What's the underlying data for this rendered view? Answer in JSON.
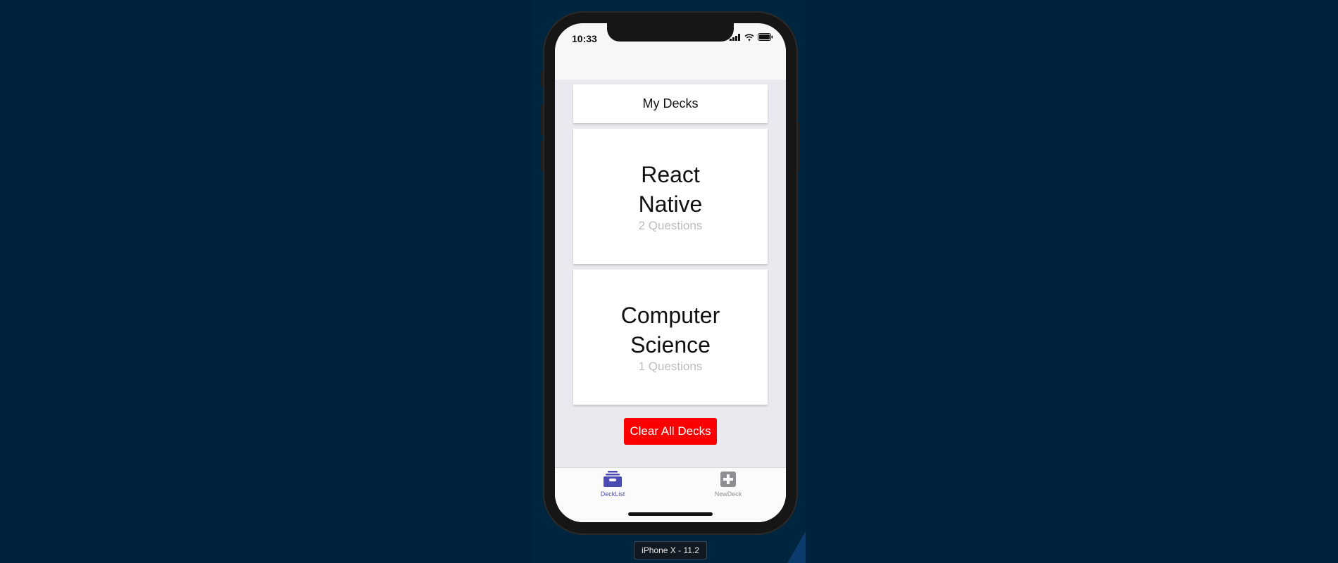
{
  "status_bar": {
    "time": "10:33"
  },
  "header": {
    "title": "My Decks"
  },
  "decks": [
    {
      "title": "React Native",
      "count_label": "2 Questions"
    },
    {
      "title": "Computer Science",
      "count_label": "1 Questions"
    }
  ],
  "actions": {
    "clear_label": "Clear All Decks"
  },
  "tabs": [
    {
      "label": "DeckList",
      "icon": "archive-icon",
      "active": true
    },
    {
      "label": "NewDeck",
      "icon": "plus-square-icon",
      "active": false
    }
  ],
  "device": {
    "label": "iPhone X - 11.2"
  },
  "colors": {
    "background": "#00233d",
    "clear_button": "#fb0000",
    "tab_active": "#4b4bb3",
    "tab_inactive": "#8e8e93",
    "question_count": "#bdbdbd"
  }
}
